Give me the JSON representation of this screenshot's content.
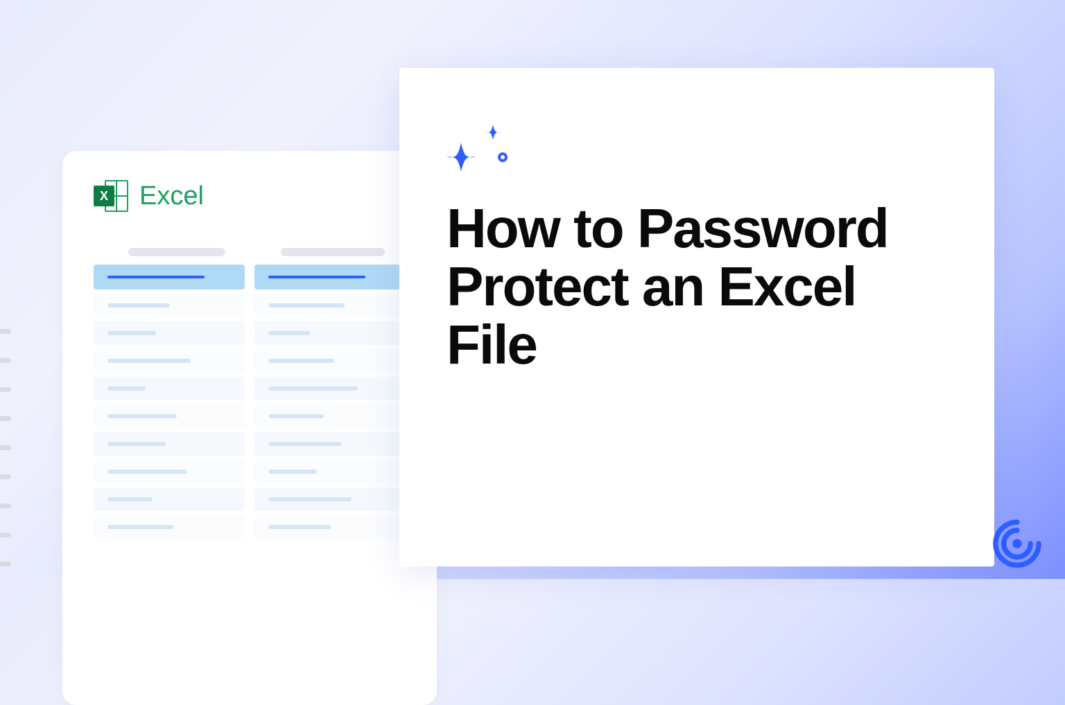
{
  "excel": {
    "label": "Excel",
    "icon_letter": "X"
  },
  "title": "How to Password Protect an Excel File",
  "colors": {
    "accent": "#2f5eff",
    "excel_green": "#1d9f5f"
  },
  "spreadsheet": {
    "rows": [
      {
        "w1": 90,
        "w2": 110
      },
      {
        "w1": 70,
        "w2": 60
      },
      {
        "w1": 120,
        "w2": 95
      },
      {
        "w1": 55,
        "w2": 130
      },
      {
        "w1": 100,
        "w2": 80
      },
      {
        "w1": 85,
        "w2": 105
      },
      {
        "w1": 115,
        "w2": 70
      },
      {
        "w1": 65,
        "w2": 120
      },
      {
        "w1": 95,
        "w2": 90
      }
    ]
  }
}
